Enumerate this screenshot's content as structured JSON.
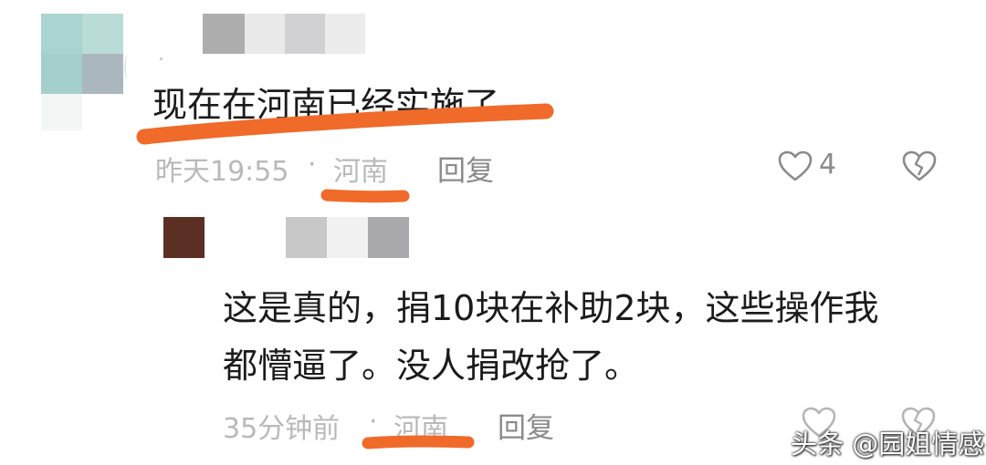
{
  "colors": {
    "underline": "#f06a2a",
    "text": "#1b1b1b",
    "meta": "#b9b9b9",
    "reply": "#8a8a8a"
  },
  "comment1": {
    "text": "现在在河南已经实施了",
    "time": "昨天19:55",
    "separator": "·",
    "location": "河南",
    "reply_label": "回复",
    "like_count": "4",
    "like_icon": "heart-outline-icon",
    "dislike_icon": "broken-heart-icon"
  },
  "comment2": {
    "text_line1": "这是真的，捐10块在补助2块，这些操作我",
    "text_line2": "都懵逼了。没人捐改抢了。",
    "time": "35分钟前",
    "separator": "·",
    "location": "河南",
    "reply_label": "回复",
    "like_icon": "heart-outline-icon",
    "dislike_icon": "broken-heart-icon"
  },
  "watermark": {
    "text": "头条 @园姐情感"
  }
}
